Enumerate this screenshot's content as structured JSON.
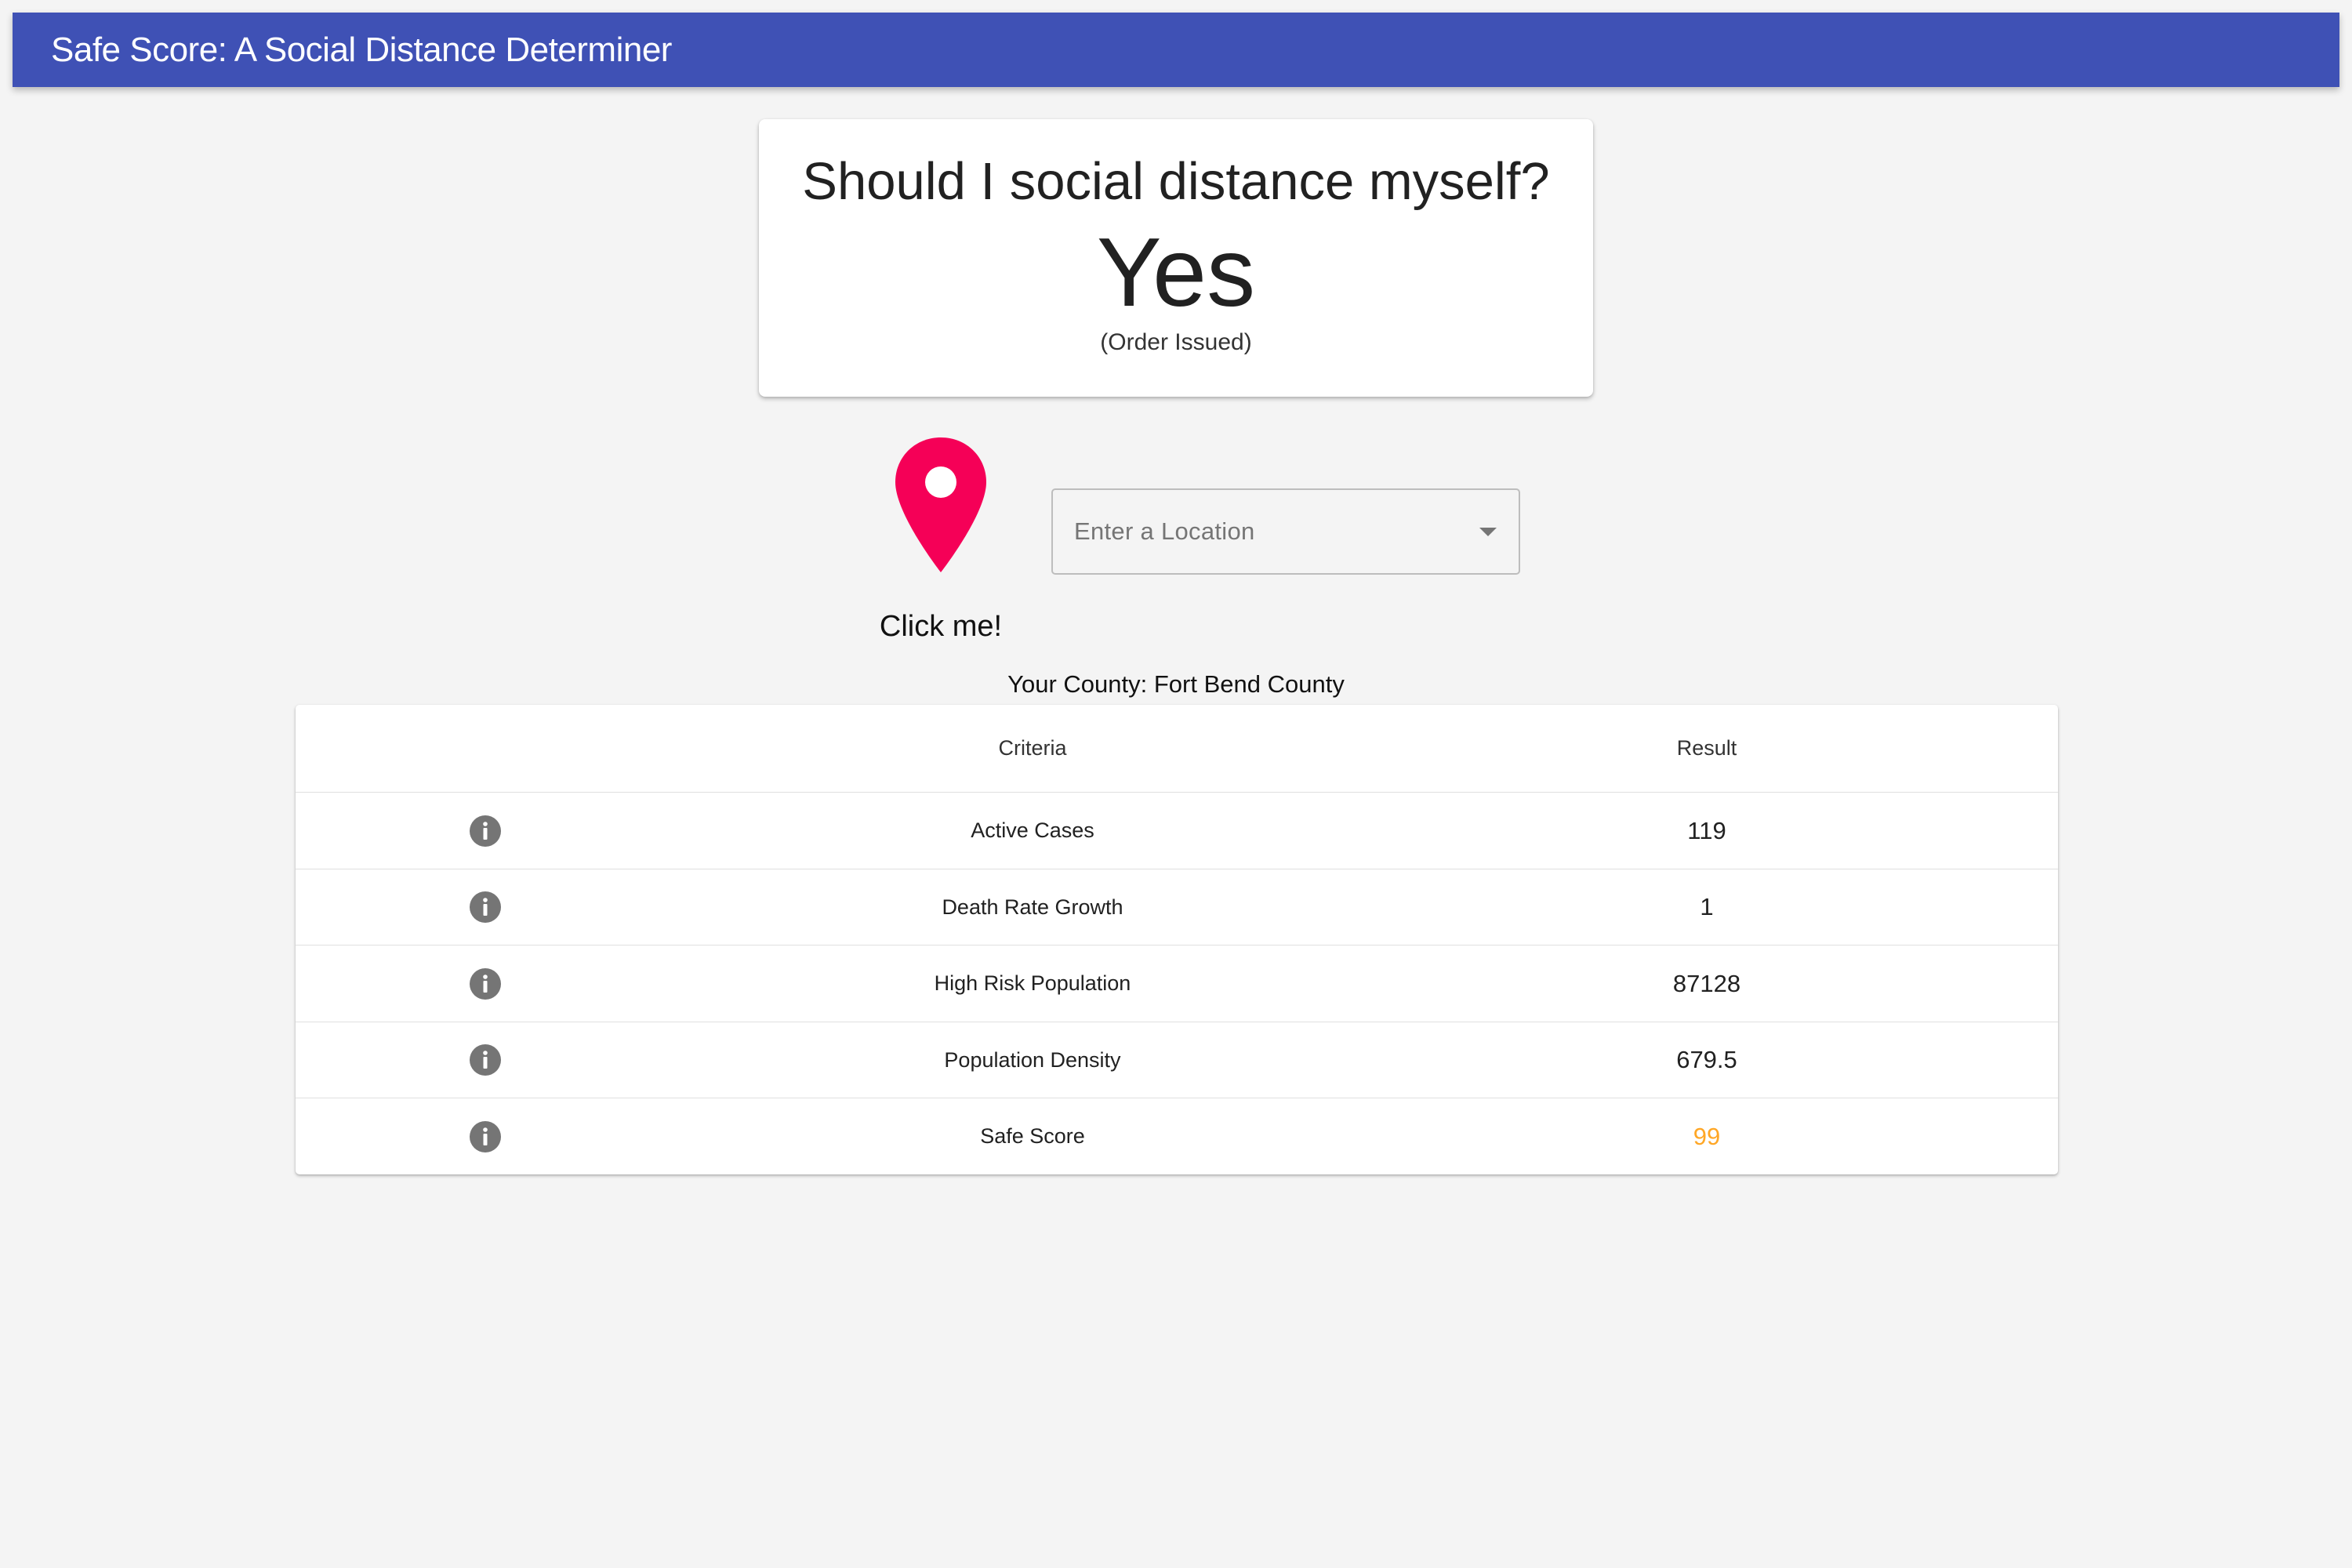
{
  "appbar": {
    "title": "Safe Score: A Social Distance Determiner",
    "color": "#3f51b5"
  },
  "answer_card": {
    "question": "Should I social distance myself?",
    "answer": "Yes",
    "note": "(Order Issued)"
  },
  "locate": {
    "icon": "location-pin-icon",
    "icon_color": "#f50057",
    "label": "Click me!"
  },
  "location_select": {
    "placeholder": "Enter a Location",
    "icon": "arrow-drop-down-icon"
  },
  "county_text": "Your County: Fort Bend County",
  "table": {
    "headers": {
      "criteria": "Criteria",
      "result": "Result"
    },
    "rows": [
      {
        "icon": "info-icon",
        "criteria": "Active Cases",
        "result": "119",
        "result_color": "#212121"
      },
      {
        "icon": "info-icon",
        "criteria": "Death Rate Growth",
        "result": "1",
        "result_color": "#212121"
      },
      {
        "icon": "info-icon",
        "criteria": "High Risk Population",
        "result": "87128",
        "result_color": "#212121"
      },
      {
        "icon": "info-icon",
        "criteria": "Population Density",
        "result": "679.5",
        "result_color": "#212121"
      },
      {
        "icon": "info-icon",
        "criteria": "Safe Score",
        "result": "99",
        "result_color": "#ffa726"
      }
    ]
  }
}
